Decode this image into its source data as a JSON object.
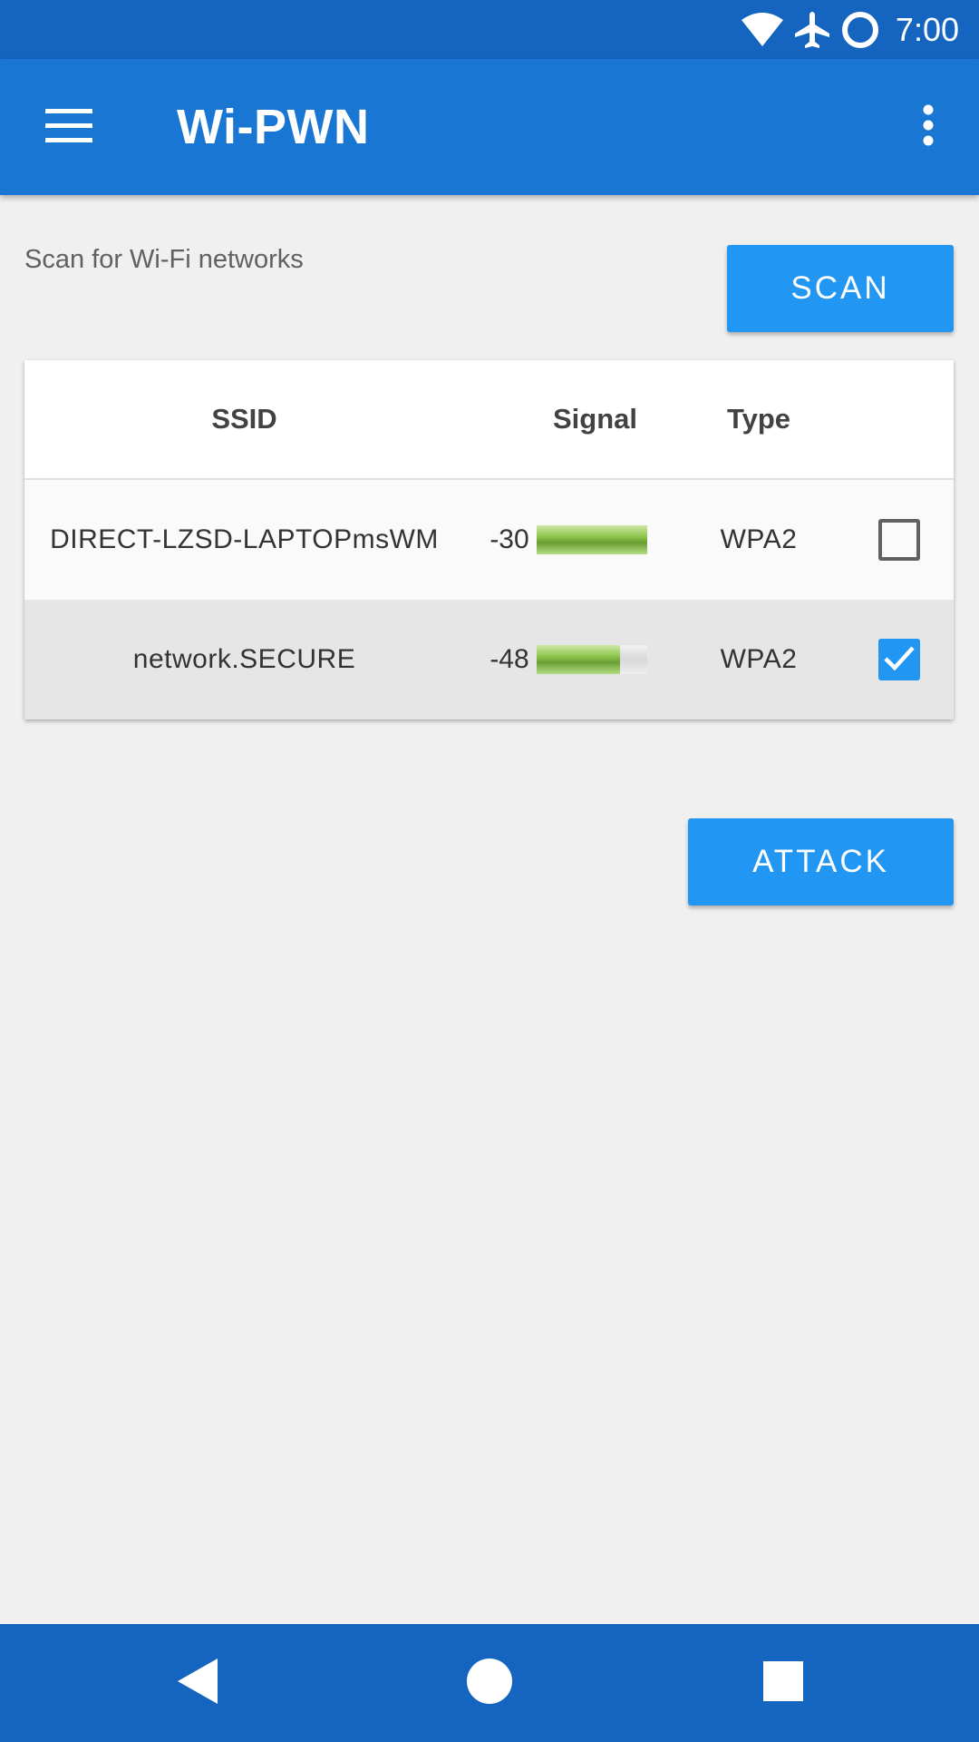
{
  "status_bar": {
    "time": "7:00",
    "icons": [
      "wifi-icon",
      "airplane-icon",
      "circle-icon"
    ],
    "color": "#1565c0"
  },
  "app_bar": {
    "title": "Wi-PWN",
    "color": "#1976d2",
    "icons": [
      "hamburger-menu-icon",
      "more-vert-icon"
    ]
  },
  "scan": {
    "label": "Scan for Wi-Fi networks",
    "button_label": "SCAN"
  },
  "table": {
    "headers": {
      "ssid": "SSID",
      "signal": "Signal",
      "type": "Type"
    },
    "rows": [
      {
        "ssid": "DIRECT-LZSD-LAPTOPmsWM",
        "signal": "-30",
        "signal_strength": 1.0,
        "type": "WPA2",
        "selected": false
      },
      {
        "ssid": "network.SECURE",
        "signal": "-48",
        "signal_strength": 0.76,
        "type": "WPA2",
        "selected": true
      }
    ]
  },
  "attack": {
    "button_label": "ATTACK"
  },
  "accent_color": "#2196f3",
  "signal_color": "#8bc34a",
  "nav_bar": {
    "icons": [
      "back-icon",
      "home-icon",
      "recent-apps-icon"
    ],
    "color": "#1565c0"
  }
}
